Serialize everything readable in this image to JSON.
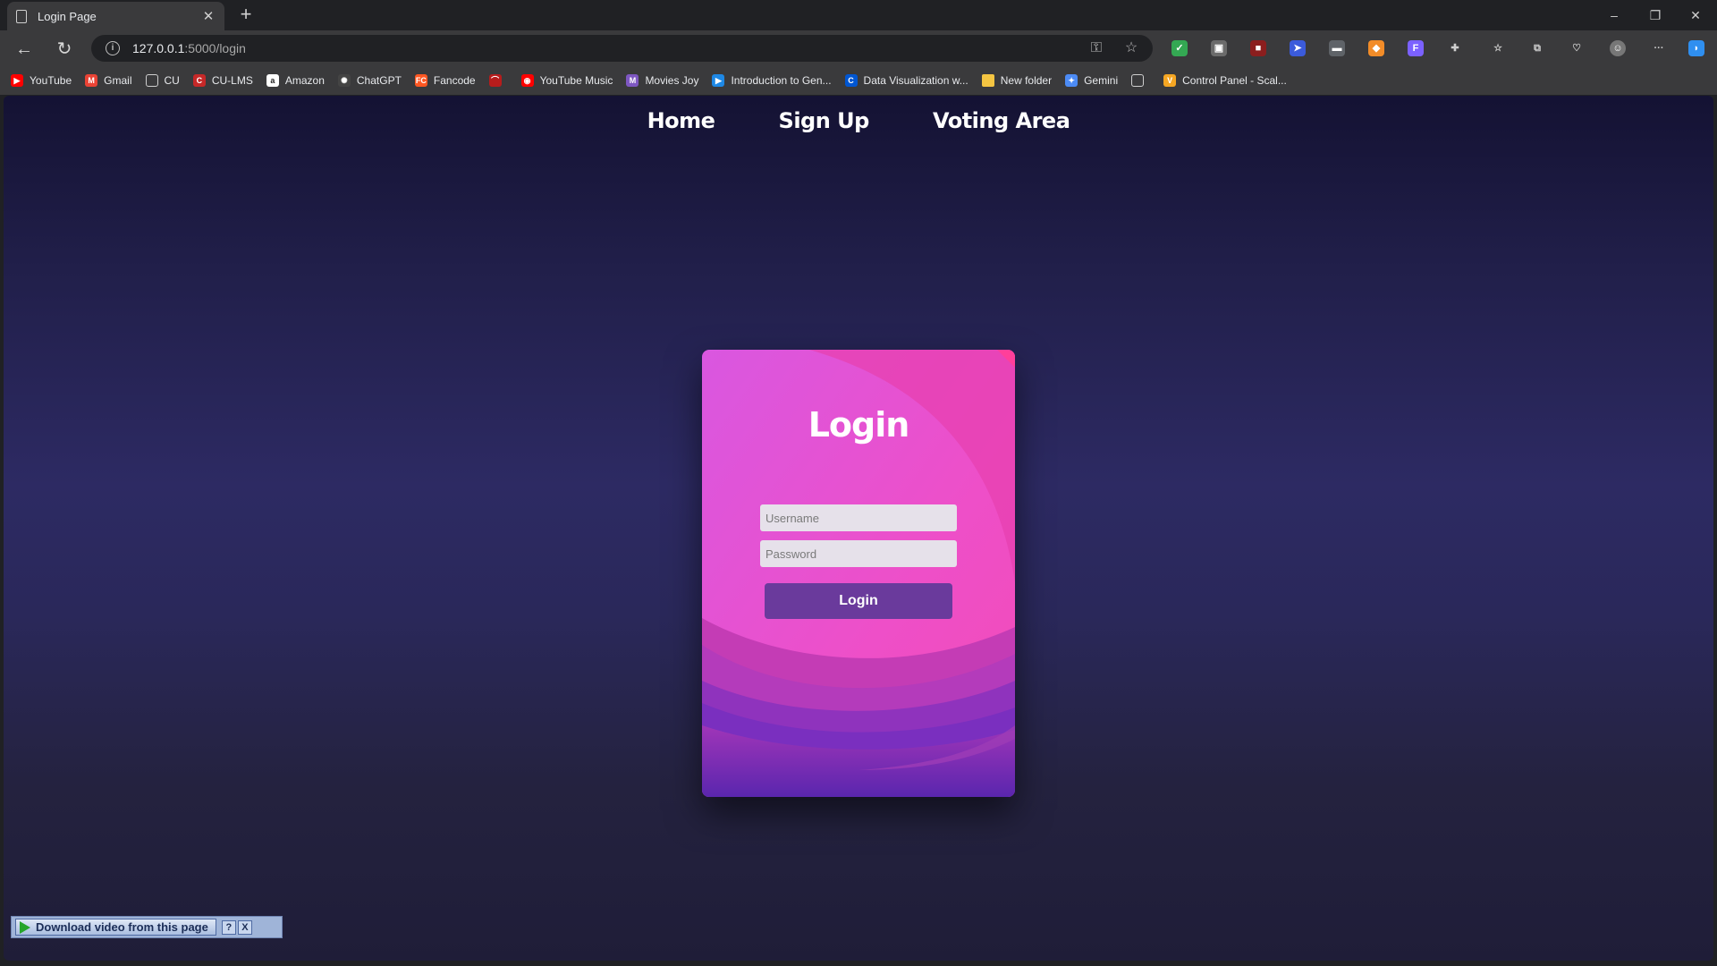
{
  "browser": {
    "tab_title": "Login Page",
    "tab_close": "✕",
    "new_tab": "+",
    "url_host": "127.0.0.1",
    "url_path": ":5000/login",
    "window_controls": {
      "minimize": "–",
      "restore": "❐",
      "close": "✕"
    },
    "nav": {
      "back": "←",
      "reload": "↻"
    },
    "extensions": [
      {
        "icon": "shield-check-icon",
        "color": "#34a853"
      },
      {
        "icon": "window-icon",
        "color": "#6b6b6b"
      },
      {
        "icon": "red-square-icon",
        "color": "#8b1e1e"
      },
      {
        "icon": "cursor-icon",
        "color": "#3b5bdb"
      },
      {
        "icon": "folder-grey-icon",
        "color": "#5f6368"
      },
      {
        "icon": "fox-icon",
        "color": "#f28c28"
      },
      {
        "icon": "gradient-f-icon",
        "color": "#7b61ff"
      }
    ],
    "toolbar_icons": [
      "puzzle-icon",
      "favorites-icon",
      "collections-icon",
      "performance-icon",
      "profile-icon",
      "more-icon",
      "copilot-icon"
    ],
    "more_label": "···"
  },
  "bookmarks": [
    {
      "label": "YouTube",
      "icon": "youtube-icon",
      "color": "#ff0000",
      "glyph": "▶"
    },
    {
      "label": "Gmail",
      "icon": "gmail-icon",
      "color": "#ea4335",
      "glyph": "M"
    },
    {
      "label": "CU",
      "icon": "page-icon",
      "color": "transparent",
      "glyph": "▯"
    },
    {
      "label": "CU-LMS",
      "icon": "cu-lms-icon",
      "color": "#c62828",
      "glyph": "C"
    },
    {
      "label": "Amazon",
      "icon": "amazon-icon",
      "color": "#ffffff",
      "glyph": "a"
    },
    {
      "label": "ChatGPT",
      "icon": "chatgpt-icon",
      "color": "#444444",
      "glyph": "✺"
    },
    {
      "label": "Fancode",
      "icon": "fancode-icon",
      "color": "#ff5722",
      "glyph": "FC"
    },
    {
      "label": "",
      "icon": "red-logo-icon",
      "color": "#b71c1c",
      "glyph": "⌒"
    },
    {
      "label": "YouTube Music",
      "icon": "youtube-music-icon",
      "color": "#ff0000",
      "glyph": "◉"
    },
    {
      "label": "Movies Joy",
      "icon": "movies-joy-icon",
      "color": "#7e57c2",
      "glyph": "M"
    },
    {
      "label": "Introduction to Gen...",
      "icon": "play-blue-icon",
      "color": "#1e88e5",
      "glyph": "▶"
    },
    {
      "label": "Data Visualization w...",
      "icon": "coursera-icon",
      "color": "#0056d2",
      "glyph": "C"
    },
    {
      "label": "New folder",
      "icon": "folder-icon",
      "color": "#f4c542",
      "glyph": ""
    },
    {
      "label": "Gemini",
      "icon": "gemini-icon",
      "color": "#4c8bf5",
      "glyph": "✦"
    },
    {
      "label": "",
      "icon": "page-icon",
      "color": "transparent",
      "glyph": "▯"
    },
    {
      "label": "Control Panel - Scal...",
      "icon": "v-logo-icon",
      "color": "#f5a623",
      "glyph": "V"
    }
  ],
  "page": {
    "nav": [
      "Home",
      "Sign Up",
      "Voting Area"
    ],
    "login": {
      "heading": "Login",
      "username_placeholder": "Username",
      "password_placeholder": "Password",
      "button_label": "Login"
    },
    "download_bar": {
      "label": "Download video from this page",
      "help": "?",
      "close": "X"
    }
  },
  "colors": {
    "card_pink": "#e94ec4",
    "card_purple": "#5b2bb0",
    "button": "#6a3a9c",
    "page_bg_mid": "#2d2a63"
  }
}
